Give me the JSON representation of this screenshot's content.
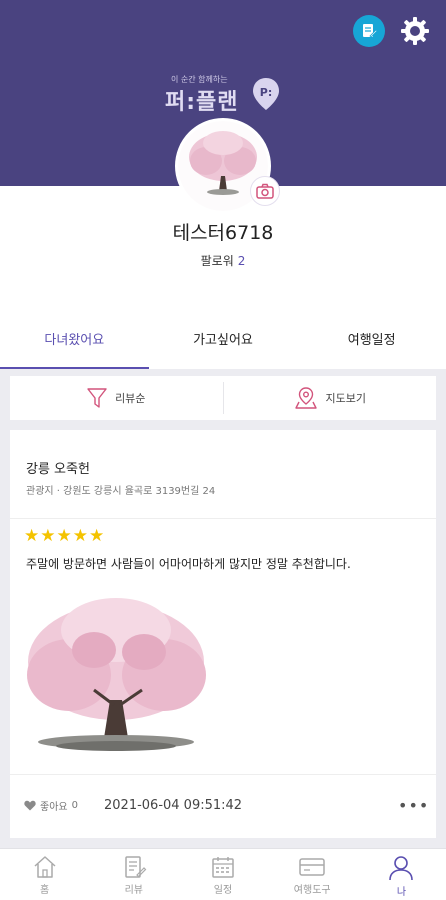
{
  "header": {
    "edit_icon": "edit-note-icon",
    "settings_icon": "gear-icon",
    "logo_tag": "이 순간 함께하는",
    "logo_main": "퍼:플랜",
    "logo_pin_letter": "P:",
    "colors": {
      "background": "#4a4380",
      "accent": "#5a4fb0",
      "edit_icon_bg": "#17a6d6"
    }
  },
  "profile": {
    "username": "테스터6718",
    "follower_label": "팔로워",
    "follower_count": "2"
  },
  "tabs": [
    {
      "label": "다녀왔어요",
      "active": true
    },
    {
      "label": "가고싶어요",
      "active": false
    },
    {
      "label": "여행일정",
      "active": false
    }
  ],
  "filters": {
    "sort_label": "리뷰순",
    "map_label": "지도보기"
  },
  "review": {
    "place_name": "강릉 오죽헌",
    "place_sub": "관광지 · 강원도 강릉시 율곡로 3139번길 24",
    "rating": 5,
    "stars": "★★★★★",
    "text": "주말에 방문하면 사람들이 어마어마하게 많지만 정말 추천합니다.",
    "like_label": "좋아요",
    "like_count": "0",
    "datetime": "2021-06-04 09:51:42",
    "more": "•••"
  },
  "bottom_nav": [
    {
      "label": "홈",
      "icon": "home-icon",
      "active": false
    },
    {
      "label": "리뷰",
      "icon": "review-icon",
      "active": false
    },
    {
      "label": "일정",
      "icon": "calendar-icon",
      "active": false
    },
    {
      "label": "여행도구",
      "icon": "travel-tools-icon",
      "active": false
    },
    {
      "label": "나",
      "icon": "person-icon",
      "active": true
    }
  ]
}
